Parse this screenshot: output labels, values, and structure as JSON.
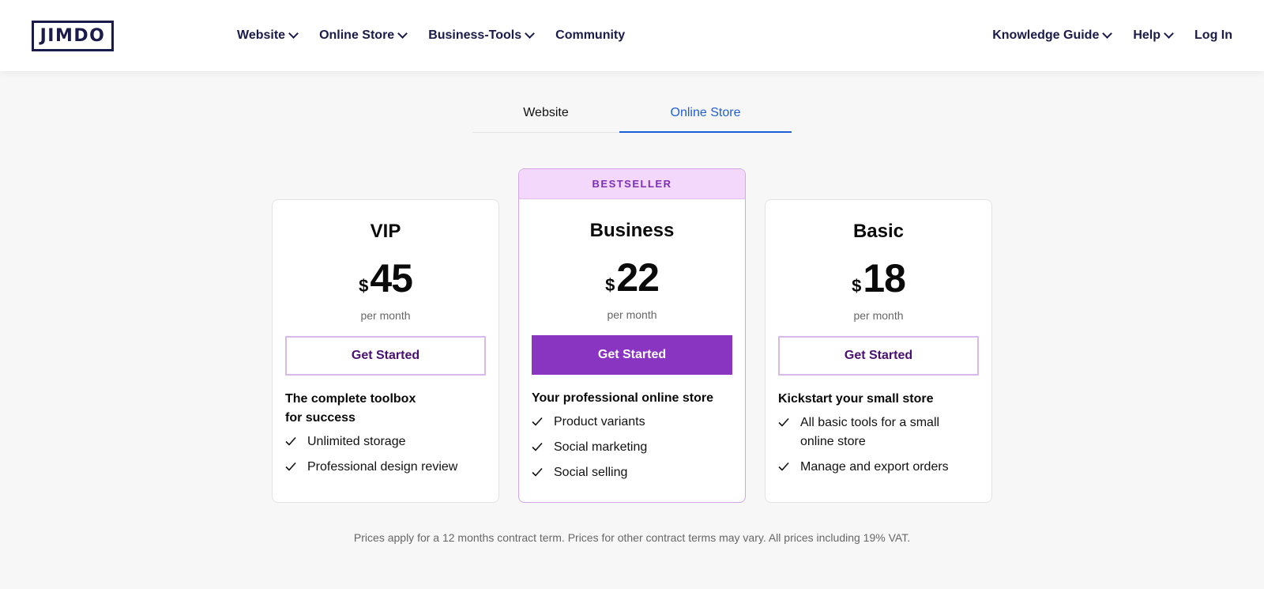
{
  "brand": {
    "logo_text": "JIMDO"
  },
  "nav": {
    "left": [
      {
        "label": "Website",
        "has_dropdown": true
      },
      {
        "label": "Online Store",
        "has_dropdown": true
      },
      {
        "label": "Business-Tools",
        "has_dropdown": true
      },
      {
        "label": "Community",
        "has_dropdown": false
      }
    ],
    "right": [
      {
        "label": "Knowledge Guide",
        "has_dropdown": true
      },
      {
        "label": "Help",
        "has_dropdown": true
      },
      {
        "label": "Log In",
        "has_dropdown": false
      }
    ]
  },
  "tabs": [
    {
      "label": "Website",
      "active": false
    },
    {
      "label": "Online Store",
      "active": true
    }
  ],
  "plans": [
    {
      "name": "VIP",
      "currency": "$",
      "price": "45",
      "period": "per month",
      "cta": "Get Started",
      "tagline_lines": [
        "The complete toolbox",
        "for success"
      ],
      "features": [
        "Unlimited storage",
        "Professional design review"
      ]
    },
    {
      "badge": "BESTSELLER",
      "name": "Business",
      "currency": "$",
      "price": "22",
      "period": "per month",
      "cta": "Get Started",
      "tagline": "Your professional online store",
      "features": [
        "Product variants",
        "Social marketing",
        "Social selling"
      ]
    },
    {
      "name": "Basic",
      "currency": "$",
      "price": "18",
      "period": "per month",
      "cta": "Get Started",
      "tagline": "Kickstart your small store",
      "features": [
        "All basic tools for a small online store",
        "Manage and export orders"
      ]
    }
  ],
  "footnote": "Prices apply for a 12 months contract term. Prices for other contract terms may vary. All prices including 19% VAT.",
  "colors": {
    "brand_navy": "#1a1a4b",
    "accent_purple": "#8a35c2",
    "badge_bg": "#f3d8fb",
    "active_tab_blue": "#1f5fd6",
    "page_bg": "#f7f7f7"
  }
}
